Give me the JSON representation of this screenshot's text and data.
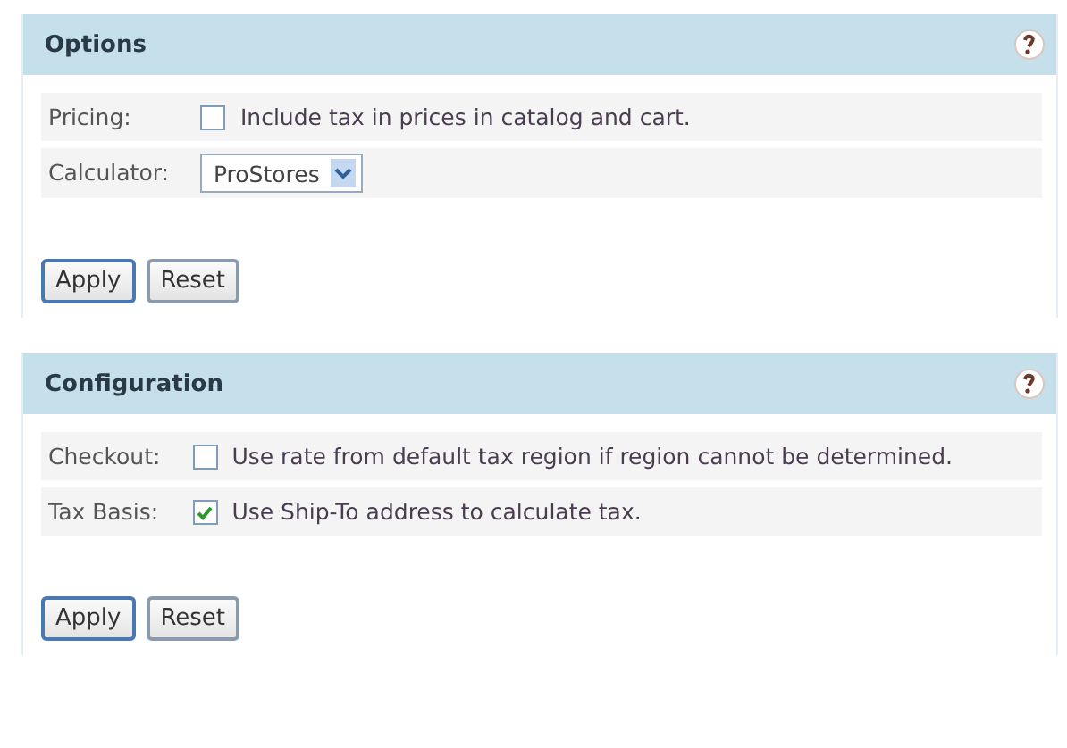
{
  "panels": [
    {
      "title": "Options",
      "rows": [
        {
          "label": "Pricing:",
          "kind": "checkbox",
          "checked": false,
          "text": "Include tax in prices in catalog and cart."
        },
        {
          "label": "Calculator:",
          "kind": "select",
          "value": "ProStores"
        }
      ],
      "buttons": [
        "Apply",
        "Reset"
      ]
    },
    {
      "title": "Configuration",
      "rows": [
        {
          "label": "Checkout:",
          "kind": "checkbox",
          "checked": false,
          "text": "Use rate from default tax region if region cannot be determined."
        },
        {
          "label": "Tax Basis:",
          "kind": "checkbox",
          "checked": true,
          "text": "Use Ship-To address to calculate tax."
        }
      ],
      "buttons": [
        "Apply",
        "Reset"
      ]
    }
  ]
}
